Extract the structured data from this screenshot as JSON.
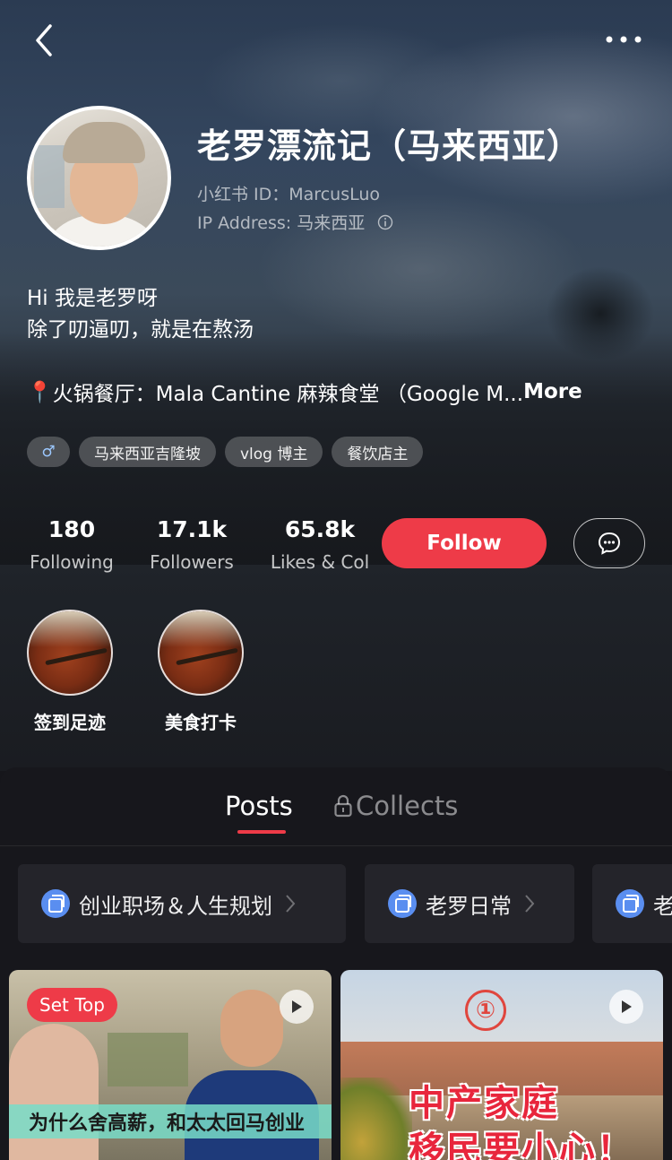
{
  "profile": {
    "name": "老罗漂流记（马来西亚）",
    "id_line": "小红书 ID：MarcusLuo",
    "ip_line": "IP Address: 马来西亚"
  },
  "bio": {
    "line1": "Hi 我是老罗呀",
    "line2": "除了叨逼叨，就是在熬汤",
    "location_pin": "📍",
    "location_text": "火锅餐厅：Mala Cantine 麻辣食堂 （Google M...",
    "more_label": "More"
  },
  "tags": {
    "gender_symbol": "♂",
    "items": [
      "马来西亚吉隆坡",
      "vlog 博主",
      "餐饮店主"
    ]
  },
  "stats": {
    "following": {
      "value": "180",
      "label": "Following"
    },
    "followers": {
      "value": "17.1k",
      "label": "Followers"
    },
    "likes": {
      "value": "65.8k",
      "label": "Likes & Col"
    }
  },
  "actions": {
    "follow_label": "Follow"
  },
  "collections": [
    {
      "label": "签到足迹"
    },
    {
      "label": "美食打卡"
    }
  ],
  "tabs": {
    "posts": "Posts",
    "collects": "Collects"
  },
  "albums": [
    "创业职场＆人生规划",
    "老罗日常",
    "老"
  ],
  "posts": [
    {
      "badge": "Set Top",
      "caption": "为什么舍高薪，和太太回马创业"
    },
    {
      "number": "①",
      "headline_line1": "中产家庭",
      "headline_line2": "移民要小心！"
    }
  ],
  "colors": {
    "accent": "#ee3b48",
    "album_icon": "#5a8ef0"
  }
}
